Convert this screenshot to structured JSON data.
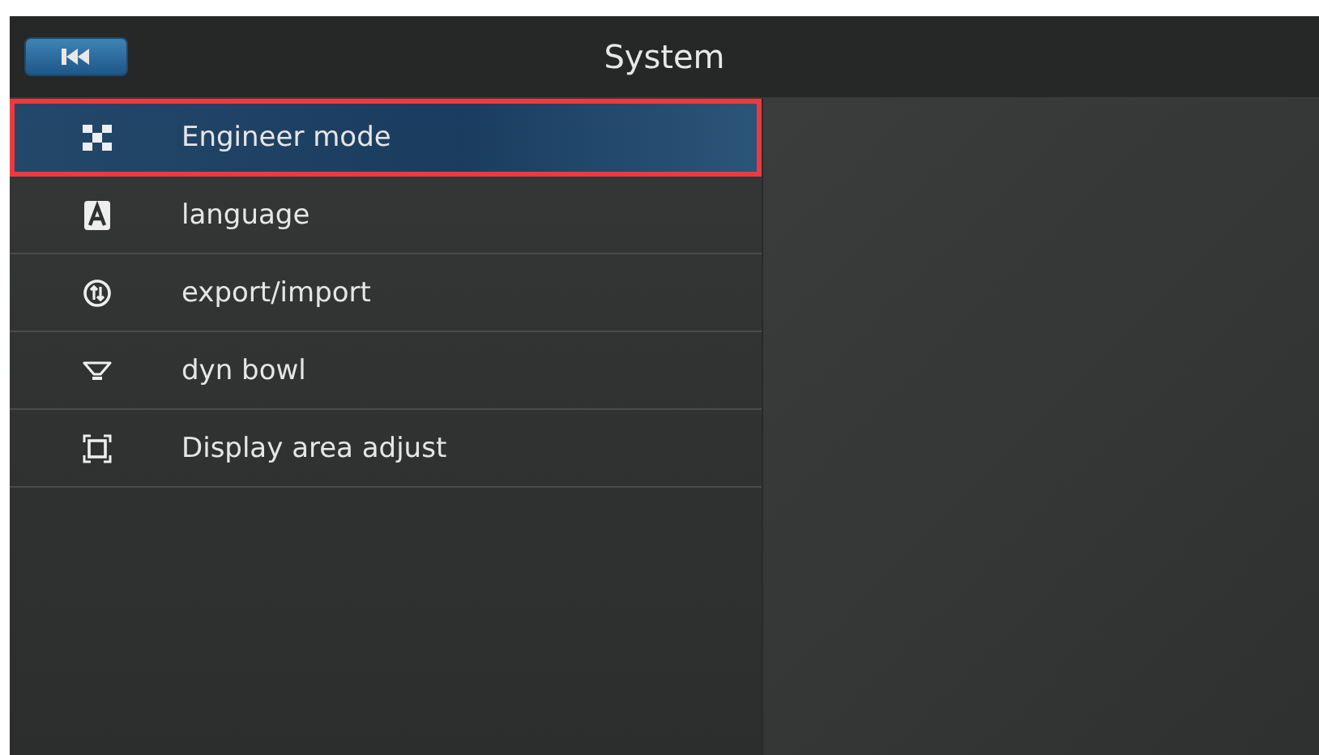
{
  "header": {
    "title": "System"
  },
  "menu": [
    {
      "kind": "grid",
      "label": "Engineer mode",
      "selected": true
    },
    {
      "kind": "letter",
      "label": "language",
      "selected": false
    },
    {
      "kind": "transfer",
      "label": "export/import",
      "selected": false
    },
    {
      "kind": "bowl",
      "label": "dyn bowl",
      "selected": false
    },
    {
      "kind": "frame",
      "label": "Display area adjust",
      "selected": false
    }
  ]
}
